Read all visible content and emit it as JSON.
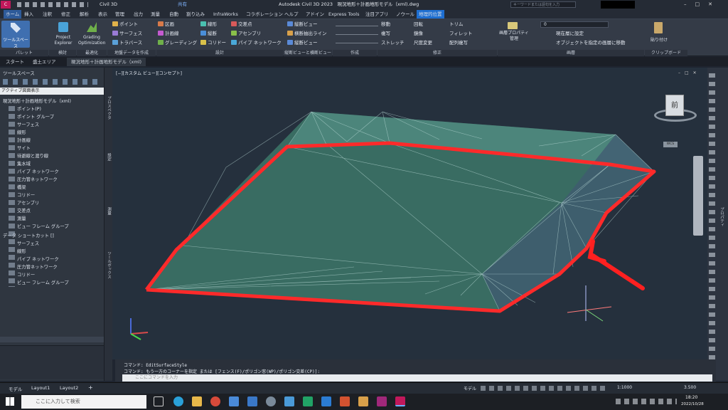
{
  "app": {
    "title": "Autodesk Civil 3D 2023　現況地形＋計画地形モデル（xml).dwg",
    "logo": "C",
    "workspace": "Civil 3D",
    "share": "共有",
    "search_placeholder": "キーワードまたは語句を入力",
    "accent": "#c2185b"
  },
  "menu": [
    "ホーム",
    "挿入",
    "注釈",
    "修正",
    "解析",
    "表示",
    "管理",
    "出力",
    "測量",
    "自動",
    "割り込み",
    "InfraWorks",
    "コラボレーション",
    "ヘルプ",
    "アドイン",
    "Express Tools",
    "注目アプリ",
    "ノウール",
    "地理的位置"
  ],
  "ribbon": {
    "big_buttons": [
      "ツールスペース",
      "Project Explorer",
      "Grading Optimization"
    ],
    "col1": [
      "ポイント",
      "サーフェス",
      "トラバース"
    ],
    "col2": [
      "区画",
      "計画線",
      "グレーディング"
    ],
    "col3": [
      "線形",
      "縦断",
      "コリドー"
    ],
    "col4": [
      "交差点",
      "アセンブリ",
      "パイプ ネットワーク"
    ],
    "col5": [
      "縦断ビュー",
      "横断抽出ライン",
      "縦断ビュー"
    ],
    "modify": [
      "移動",
      "回転",
      "トリム",
      "複写",
      "鏡像",
      "フィレット",
      "ストレッチ",
      "尺度変更",
      "配列複写"
    ],
    "layer_current": "0",
    "layer_items": [
      "現在層に設定",
      "オブジェクトを指定の画層に移動"
    ],
    "layer_props": "画層プロパティ管理",
    "paste": "貼り付け",
    "panels": [
      "パレット",
      "検討",
      "最適化",
      "地盤データを作成",
      "設計",
      "縦断ビューと横断ビュー",
      "作成",
      "修正",
      "画層",
      "クリップボード"
    ]
  },
  "doc_tabs": [
    "スタート",
    "盛土エリア",
    "現況地形＋計画地形モデル（xml)"
  ],
  "palette": {
    "title": "ツールスペース",
    "dropdown": "アクティブ図面表示",
    "tree": [
      "現況地形＋計画地形モデル（xml)",
      "ポイント(P)",
      "ポイント グループ",
      "サーフェス",
      "線形",
      "計画線",
      "サイト",
      "待避線と渡り線",
      "集水域",
      "パイプ ネットワーク",
      "圧力管ネットワーク",
      "橋梁",
      "コリドー",
      "アセンブリ",
      "交差点",
      "測量",
      "ビュー フレーム グループ",
      "データ ショートカット []",
      "サーフェス",
      "線形",
      "パイプ ネットワーク",
      "圧力管ネットワーク",
      "コリドー",
      "ビュー フレーム グループ"
    ],
    "side_tabs": [
      "プロスペクタ",
      "設定",
      "測量",
      "ツールボックス"
    ]
  },
  "viewport": {
    "label": "[−][カスタム ビュー][コンセプト]",
    "viewcube_face": "前",
    "wcs": "WCS",
    "side_label": "プロパティ"
  },
  "command": {
    "line1": "コマンド: EditSurfaceStyle",
    "line2": "コマンド: もう一方のコーナーを指定 または [フェンス(F)/ポリゴン窓(WP)/ポリゴン交差(CP)]:",
    "input_placeholder": "ここにコマンドを入力"
  },
  "layout_tabs": [
    "モデル",
    "Layout1",
    "Layout2",
    "+"
  ],
  "status": {
    "model": "モデル",
    "scale": "1:1000",
    "value": "3.500"
  },
  "taskbar": {
    "search_placeholder": "ここに入力して検索",
    "time": "18:20",
    "date": "2022/10/28"
  }
}
